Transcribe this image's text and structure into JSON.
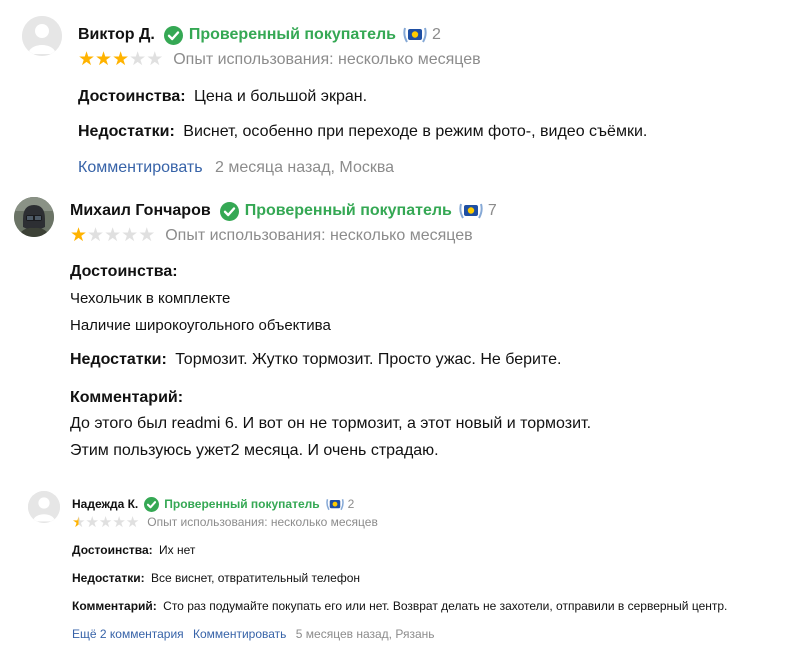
{
  "reviews": [
    {
      "author": "Виктор Д.",
      "verified_label": "Проверенный покупатель",
      "badge_count": "2",
      "rating": 3,
      "experience": "Опыт использования: несколько месяцев",
      "pros_label": "Достоинства:",
      "pros_text": "Цена и большой экран.",
      "cons_label": "Недостатки:",
      "cons_text": "Виснет, особенно при переходе в режим фото-, видео съёмки.",
      "comment_link": "Комментировать",
      "meta": "2 месяца назад, Москва"
    },
    {
      "author": "Михаил Гончаров",
      "verified_label": "Проверенный покупатель",
      "badge_count": "7",
      "rating": 1,
      "experience": "Опыт использования: несколько месяцев",
      "pros_label": "Достоинства:",
      "pros_lines": [
        "Чехольчик в комплекте",
        "Наличие широкоугольного объектива"
      ],
      "cons_label": "Недостатки:",
      "cons_text": "Тормозит. Жутко тормозит. Просто ужас. Не берите.",
      "comment_label": "Комментарий:",
      "comment_lines": [
        "До этого был readmi 6. И вот он не тормозит, а этот новый и тормозит.",
        "Этим пользуюсь ужет2 месяца. И очень страдаю."
      ]
    },
    {
      "author": "Надежда К.",
      "verified_label": "Проверенный покупатель",
      "badge_count": "2",
      "rating": 1,
      "experience": "Опыт использования: несколько месяцев",
      "pros_label": "Достоинства:",
      "pros_text": "Их нет",
      "cons_label": "Недостатки:",
      "cons_text": "Все виснет, отвратительный телефон",
      "comment_label": "Комментарий:",
      "comment_text": "Сто раз подумайте покупать его или нет. Возврат делать не захотели, отправили в серверный центр.",
      "more_comments_link": "Ещё 2 комментария",
      "comment_link": "Комментировать",
      "meta": "5 месяцев назад, Рязань"
    }
  ],
  "colors": {
    "verified": "#35a854",
    "link": "#3763a8",
    "star_on": "#ffb300",
    "star_off": "#e0e0e0",
    "muted": "#8c8c8c"
  },
  "icons": {
    "verified": "check-circle-icon",
    "badge": "laurel-medal-icon",
    "avatar": "user-avatar-icon"
  }
}
